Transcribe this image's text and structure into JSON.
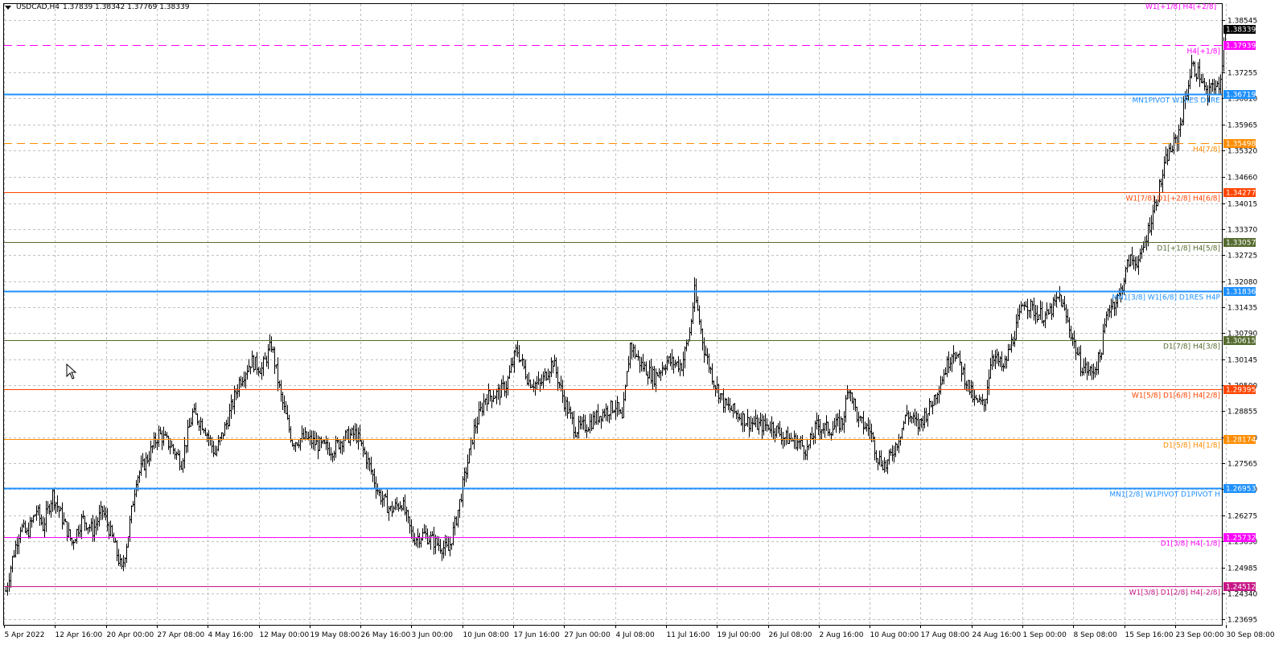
{
  "header": {
    "symbol_tf": "USDCAD,H4",
    "ohlc": "1.37839 1.38342 1.37769 1.38339"
  },
  "top_label": {
    "text": "W1[+1/8] H4[+2/8]",
    "color": "#ff00ff"
  },
  "current_price": {
    "label": "1.38339",
    "value": 1.38339,
    "bg": "#000000"
  },
  "price_axis": {
    "ticks": [
      "1.38545",
      "1.37255",
      "1.36610",
      "1.35965",
      "1.35320",
      "1.34660",
      "1.34015",
      "1.33370",
      "1.32725",
      "1.32080",
      "1.31435",
      "1.30790",
      "1.30145",
      "1.29500",
      "1.28855",
      "1.28210",
      "1.27565",
      "1.26920",
      "1.26275",
      "1.25630",
      "1.24985",
      "1.24340",
      "1.23695"
    ],
    "min": 1.2356,
    "max": 1.3895
  },
  "time_axis": {
    "labels": [
      "5 Apr 2022",
      "12 Apr 16:00",
      "20 Apr 00:00",
      "27 Apr 08:00",
      "4 May 16:00",
      "12 May 00:00",
      "19 May 08:00",
      "26 May 16:00",
      "3 Jun 00:00",
      "10 Jun 08:00",
      "17 Jun 16:00",
      "27 Jun 00:00",
      "4 Jul 08:00",
      "11 Jul 16:00",
      "19 Jul 00:00",
      "26 Jul 08:00",
      "2 Aug 16:00",
      "10 Aug 00:00",
      "17 Aug 08:00",
      "24 Aug 16:00",
      "1 Sep 00:00",
      "8 Sep 08:00",
      "15 Sep 16:00",
      "23 Sep 00:00",
      "30 Sep 08:00"
    ]
  },
  "levels": [
    {
      "label": "H4[+1/8]",
      "price_label": "1.37939",
      "value": 1.37939,
      "color": "#ff00ff",
      "dash": true,
      "width": 1
    },
    {
      "label": "MN1PIVOT W1RES D1RE",
      "price_label": "1.36719",
      "value": 1.36719,
      "color": "#1e90ff",
      "dash": false,
      "width": 2
    },
    {
      "label": "H4[7/8]",
      "price_label": "1.35498",
      "value": 1.35498,
      "color": "#ff8c00",
      "dash": true,
      "width": 1
    },
    {
      "label": "W1[7/8] D1[+2/8] H4[6/8]",
      "price_label": "1.34277",
      "value": 1.34277,
      "color": "#ff4500",
      "dash": false,
      "width": 1
    },
    {
      "label": "D1[+1/8] H4[5/8]",
      "price_label": "1.33057",
      "value": 1.33057,
      "color": "#556b2f",
      "dash": false,
      "width": 1
    },
    {
      "label": "MN1[3/8] W1[6/8] D1RES H4P",
      "price_label": "1.31836",
      "value": 1.31836,
      "color": "#1e90ff",
      "dash": false,
      "width": 2
    },
    {
      "label": "D1[7/8] H4[3/8]",
      "price_label": "1.30615",
      "value": 1.30615,
      "color": "#556b2f",
      "dash": false,
      "width": 1
    },
    {
      "label": "W1[5/8] D1[6/8] H4[2/8]",
      "price_label": "1.29395",
      "value": 1.29395,
      "color": "#ff4500",
      "dash": false,
      "width": 1
    },
    {
      "label": "D1[5/8] H4[1/8]",
      "price_label": "1.28174",
      "value": 1.28174,
      "color": "#ff8c00",
      "dash": false,
      "width": 1
    },
    {
      "label": "MN1[2/8] W1PIVOT D1PIVOT H",
      "price_label": "1.26953",
      "value": 1.26953,
      "color": "#1e90ff",
      "dash": false,
      "width": 2
    },
    {
      "label": "D1[3/8] H4[-1/8]",
      "price_label": "1.25732",
      "value": 1.25732,
      "color": "#ff00ff",
      "dash": false,
      "width": 1
    },
    {
      "label": "W1[3/8] D1[2/8] H4[-2/8]",
      "price_label": "1.24512",
      "value": 1.24512,
      "color": "#c71585",
      "dash": false,
      "width": 1
    }
  ],
  "chart_data": {
    "type": "line",
    "anchors": [
      [
        0,
        1.244
      ],
      [
        8,
        1.252
      ],
      [
        18,
        1.26
      ],
      [
        26,
        1.258
      ],
      [
        38,
        1.264
      ],
      [
        46,
        1.26
      ],
      [
        58,
        1.268
      ],
      [
        70,
        1.262
      ],
      [
        82,
        1.256
      ],
      [
        95,
        1.262
      ],
      [
        108,
        1.259
      ],
      [
        120,
        1.264
      ],
      [
        134,
        1.256
      ],
      [
        144,
        1.249
      ],
      [
        152,
        1.258
      ],
      [
        162,
        1.272
      ],
      [
        176,
        1.277
      ],
      [
        190,
        1.283
      ],
      [
        205,
        1.28
      ],
      [
        218,
        1.276
      ],
      [
        232,
        1.288
      ],
      [
        246,
        1.285
      ],
      [
        260,
        1.278
      ],
      [
        275,
        1.286
      ],
      [
        290,
        1.296
      ],
      [
        305,
        1.301
      ],
      [
        318,
        1.299
      ],
      [
        330,
        1.305
      ],
      [
        342,
        1.292
      ],
      [
        356,
        1.281
      ],
      [
        372,
        1.282
      ],
      [
        390,
        1.28
      ],
      [
        406,
        1.279
      ],
      [
        420,
        1.282
      ],
      [
        435,
        1.283
      ],
      [
        450,
        1.276
      ],
      [
        464,
        1.268
      ],
      [
        478,
        1.264
      ],
      [
        492,
        1.266
      ],
      [
        506,
        1.257
      ],
      [
        520,
        1.258
      ],
      [
        534,
        1.256
      ],
      [
        550,
        1.254
      ],
      [
        560,
        1.262
      ],
      [
        570,
        1.272
      ],
      [
        582,
        1.284
      ],
      [
        596,
        1.292
      ],
      [
        612,
        1.293
      ],
      [
        622,
        1.295
      ],
      [
        635,
        1.304
      ],
      [
        650,
        1.296
      ],
      [
        664,
        1.295
      ],
      [
        680,
        1.301
      ],
      [
        694,
        1.291
      ],
      [
        708,
        1.284
      ],
      [
        722,
        1.285
      ],
      [
        740,
        1.288
      ],
      [
        758,
        1.29
      ],
      [
        766,
        1.286
      ],
      [
        776,
        1.305
      ],
      [
        790,
        1.3
      ],
      [
        806,
        1.297
      ],
      [
        822,
        1.301
      ],
      [
        840,
        1.3
      ],
      [
        850,
        1.308
      ],
      [
        856,
        1.318
      ],
      [
        868,
        1.304
      ],
      [
        880,
        1.296
      ],
      [
        894,
        1.29
      ],
      [
        908,
        1.288
      ],
      [
        922,
        1.286
      ],
      [
        936,
        1.285
      ],
      [
        952,
        1.285
      ],
      [
        968,
        1.282
      ],
      [
        984,
        1.281
      ],
      [
        996,
        1.279
      ],
      [
        1008,
        1.285
      ],
      [
        1024,
        1.284
      ],
      [
        1040,
        1.286
      ],
      [
        1048,
        1.295
      ],
      [
        1060,
        1.286
      ],
      [
        1074,
        1.284
      ],
      [
        1084,
        1.277
      ],
      [
        1094,
        1.275
      ],
      [
        1108,
        1.281
      ],
      [
        1120,
        1.288
      ],
      [
        1134,
        1.285
      ],
      [
        1150,
        1.29
      ],
      [
        1164,
        1.297
      ],
      [
        1178,
        1.304
      ],
      [
        1190,
        1.298
      ],
      [
        1204,
        1.291
      ],
      [
        1216,
        1.29
      ],
      [
        1226,
        1.303
      ],
      [
        1240,
        1.299
      ],
      [
        1254,
        1.308
      ],
      [
        1266,
        1.316
      ],
      [
        1280,
        1.313
      ],
      [
        1294,
        1.312
      ],
      [
        1310,
        1.317
      ],
      [
        1324,
        1.308
      ],
      [
        1336,
        1.3
      ],
      [
        1350,
        1.298
      ],
      [
        1360,
        1.302
      ],
      [
        1370,
        1.314
      ],
      [
        1384,
        1.317
      ],
      [
        1396,
        1.326
      ],
      [
        1410,
        1.326
      ],
      [
        1422,
        1.335
      ],
      [
        1434,
        1.344
      ],
      [
        1444,
        1.352
      ],
      [
        1456,
        1.356
      ],
      [
        1466,
        1.366
      ],
      [
        1474,
        1.374
      ],
      [
        1484,
        1.372
      ],
      [
        1494,
        1.366
      ],
      [
        1500,
        1.37
      ],
      [
        1508,
        1.368
      ],
      [
        1516,
        1.3834
      ]
    ]
  },
  "colors": {
    "grid": "#c0c0c0",
    "candle": "#000000",
    "background": "#ffffff"
  },
  "cursor_icon": "mouse-pointer-icon"
}
